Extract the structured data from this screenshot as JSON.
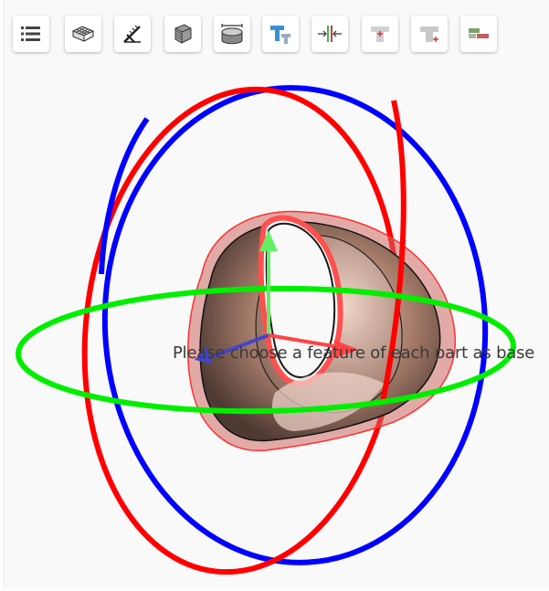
{
  "toolbar": {
    "buttons": [
      {
        "icon": "list-icon"
      },
      {
        "icon": "wireframe-cube-icon"
      },
      {
        "icon": "measure-angle-icon"
      },
      {
        "icon": "section-cube-icon"
      },
      {
        "icon": "cylinder-measure-icon"
      },
      {
        "icon": "t-shape-blue-icon"
      },
      {
        "icon": "align-center-icon"
      },
      {
        "icon": "t-shape-red-point-icon"
      },
      {
        "icon": "t-shape-corner-point-icon"
      },
      {
        "icon": "offset-bars-icon"
      }
    ]
  },
  "viewer": {
    "status_message": "Please choose a feature of each part as base"
  },
  "colors": {
    "ring_x": "#ff0000",
    "ring_y": "#0000ff",
    "ring_z": "#00ee00",
    "part_fill": "#b08570",
    "part_highlight": "#e04040"
  }
}
